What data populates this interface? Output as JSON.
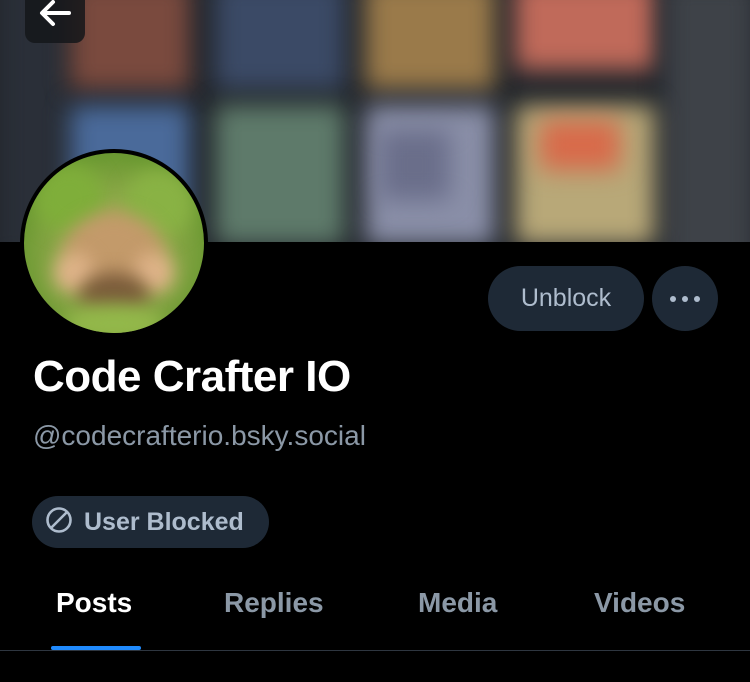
{
  "profile": {
    "display_name": "Code Crafter IO",
    "handle": "@codecrafterio.bsky.social"
  },
  "actions": {
    "unblock_label": "Unblock",
    "more_icon": "ellipsis-icon"
  },
  "badge": {
    "label": "User Blocked",
    "icon": "block-icon"
  },
  "nav": {
    "back_icon": "arrow-left-icon"
  },
  "tabs": [
    {
      "label": "Posts",
      "active": true
    },
    {
      "label": "Replies",
      "active": false
    },
    {
      "label": "Media",
      "active": false
    },
    {
      "label": "Videos",
      "active": false
    }
  ],
  "colors": {
    "accent": "#208bfe",
    "button_bg": "#1e2936",
    "muted_text": "#8b98a6"
  }
}
